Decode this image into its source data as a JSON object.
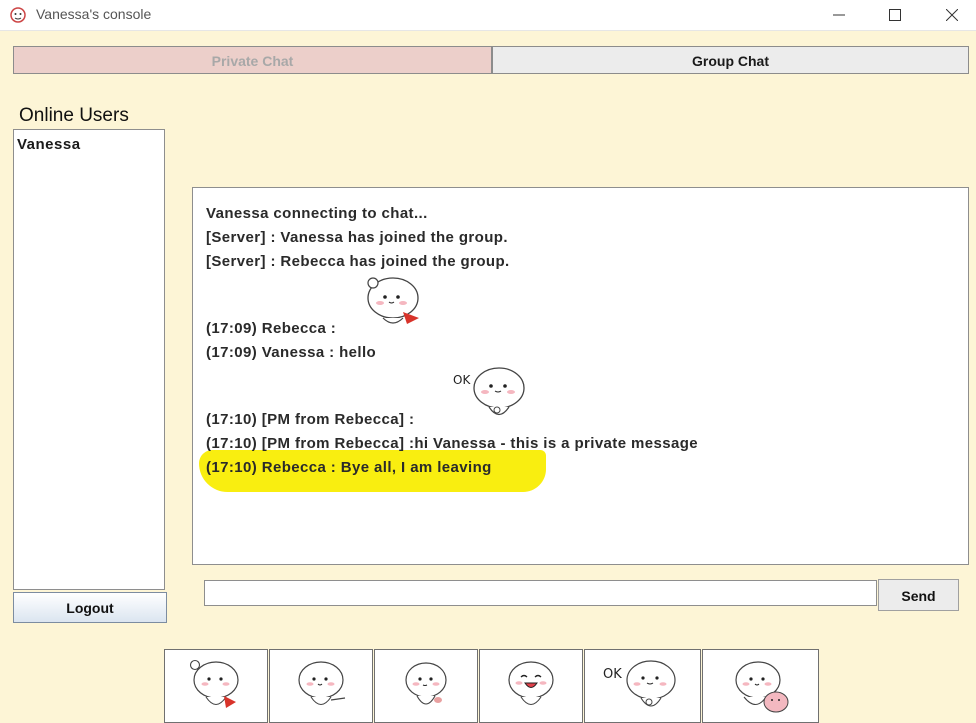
{
  "window": {
    "title": "Vanessa's console",
    "icon": "app-icon",
    "controls": [
      "minimize-icon",
      "maximize-icon",
      "close-icon"
    ]
  },
  "tabs": {
    "private_label": "Private Chat",
    "group_label": "Group Chat"
  },
  "sidebar": {
    "title": "Online Users",
    "users": [
      "Vanessa"
    ],
    "logout_label": "Logout"
  },
  "chat": {
    "lines": [
      "Vanessa connecting to chat...",
      "[Server] : Vanessa has joined the group.",
      "[Server] : Rebecca has joined the group.",
      "(17:09) Rebecca :",
      "(17:09) Vanessa : hello",
      "(17:10) [PM from Rebecca] :",
      "(17:10) [PM from Rebecca] :hi Vanessa - this is a private message",
      "(17:10) Rebecca : Bye all, I am leaving"
    ],
    "highlight_color": "#f9ee10"
  },
  "composer": {
    "input_value": "",
    "send_label": "Send"
  },
  "stickers": {
    "ok_text": "OK",
    "items": [
      "waving-sticker",
      "pointing-sticker",
      "shy-sticker",
      "laughing-sticker",
      "ok-sticker",
      "hug-sticker"
    ]
  },
  "colors": {
    "background": "#fdf5d6",
    "private_tab": "#eccfca",
    "group_tab": "#ececec"
  }
}
